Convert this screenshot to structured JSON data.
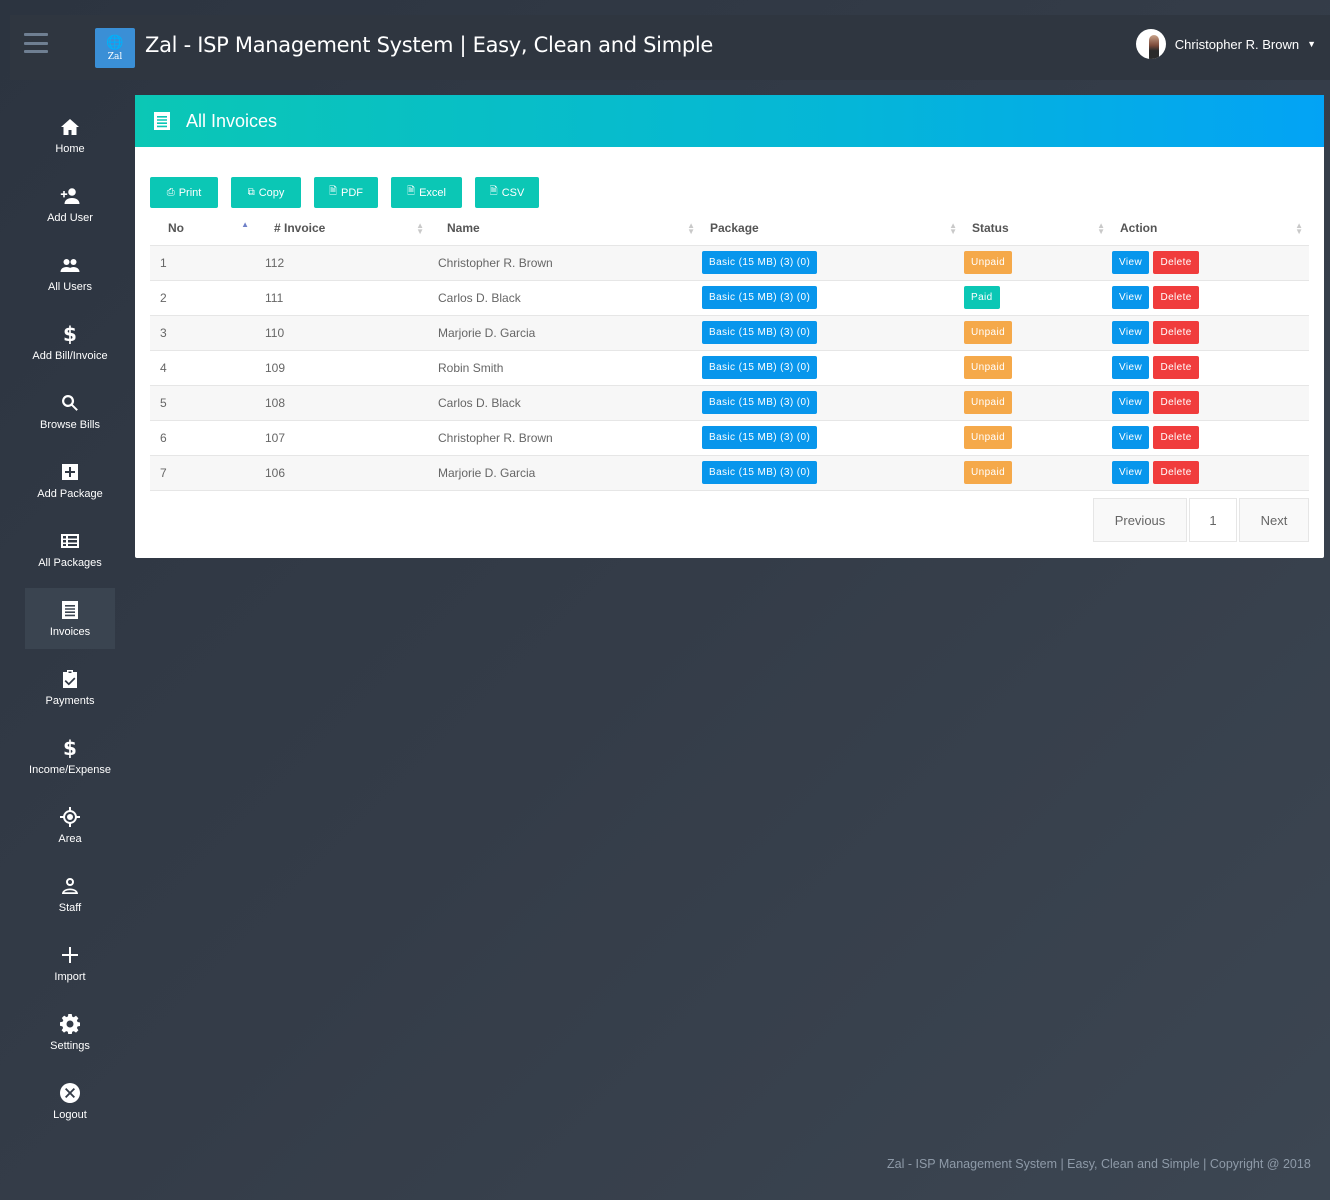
{
  "header": {
    "app_title": "Zal - ISP Management System | Easy, Clean and Simple",
    "logo_text": "Zal",
    "user_name": "Christopher R. Brown"
  },
  "sidebar": {
    "items": [
      {
        "label": "Home",
        "icon": "home-icon"
      },
      {
        "label": "Add User",
        "icon": "add-user-icon"
      },
      {
        "label": "All Users",
        "icon": "users-icon"
      },
      {
        "label": "Add Bill/Invoice",
        "icon": "dollar-icon"
      },
      {
        "label": "Browse Bills",
        "icon": "search-icon"
      },
      {
        "label": "Add Package",
        "icon": "plus-box-icon"
      },
      {
        "label": "All Packages",
        "icon": "grid-list-icon"
      },
      {
        "label": "Invoices",
        "icon": "invoice-icon"
      },
      {
        "label": "Payments",
        "icon": "clipboard-check-icon"
      },
      {
        "label": "Income/Expense",
        "icon": "dollar-icon"
      },
      {
        "label": "Area",
        "icon": "crosshair-icon"
      },
      {
        "label": "Staff",
        "icon": "person-icon"
      },
      {
        "label": "Import",
        "icon": "plus-icon"
      },
      {
        "label": "Settings",
        "icon": "gear-icon"
      },
      {
        "label": "Logout",
        "icon": "close-circle-icon"
      }
    ],
    "active": "Invoices"
  },
  "panel": {
    "title": "All Invoices",
    "export_buttons": [
      "Print",
      "Copy",
      "PDF",
      "Excel",
      "CSV"
    ],
    "columns": [
      "No",
      "# Invoice",
      "Name",
      "Package",
      "Status",
      "Action"
    ],
    "rows": [
      {
        "no": "1",
        "invoice": "112",
        "name": "Christopher R. Brown",
        "package": "Basic (15 MB) (3) (0)",
        "status": "Unpaid"
      },
      {
        "no": "2",
        "invoice": "111",
        "name": "Carlos D. Black",
        "package": "Basic (15 MB) (3) (0)",
        "status": "Paid"
      },
      {
        "no": "3",
        "invoice": "110",
        "name": "Marjorie D. Garcia",
        "package": "Basic (15 MB) (3) (0)",
        "status": "Unpaid"
      },
      {
        "no": "4",
        "invoice": "109",
        "name": "Robin Smith",
        "package": "Basic (15 MB) (3) (0)",
        "status": "Unpaid"
      },
      {
        "no": "5",
        "invoice": "108",
        "name": "Carlos D. Black",
        "package": "Basic (15 MB) (3) (0)",
        "status": "Unpaid"
      },
      {
        "no": "6",
        "invoice": "107",
        "name": "Christopher R. Brown",
        "package": "Basic (15 MB) (3) (0)",
        "status": "Unpaid"
      },
      {
        "no": "7",
        "invoice": "106",
        "name": "Marjorie D. Garcia",
        "package": "Basic (15 MB) (3) (0)",
        "status": "Unpaid"
      }
    ],
    "action_view": "View",
    "action_delete": "Delete",
    "pagination": {
      "previous": "Previous",
      "page": "1",
      "next": "Next"
    }
  },
  "footer": {
    "text": "Zal - ISP Management System | Easy, Clean and Simple | Copyright @ 2018"
  },
  "colors": {
    "accent_teal": "#0bc7b5",
    "accent_blue": "#0896ec",
    "unpaid": "#f5a94a",
    "danger": "#f03c3c"
  }
}
